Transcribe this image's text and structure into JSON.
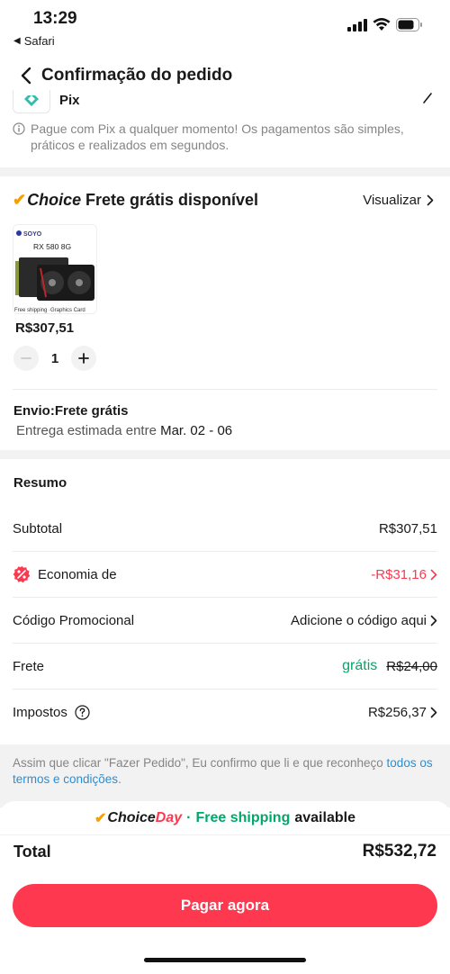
{
  "status_bar": {
    "time": "13:29",
    "back_app": "Safari"
  },
  "header": {
    "title": "Confirmação do pedido"
  },
  "payment": {
    "method_label": "Pix",
    "info_text": "Pague com Pix a qualquer momento! Os pagamentos são simples, práticos e realizados em segundos."
  },
  "choice_section": {
    "logo": "Choice",
    "title": "Frete grátis disponível",
    "view_label": "Visualizar",
    "product": {
      "image_brand": "SOYO",
      "image_model": "RX 580 8G",
      "image_caption": "Free shipping ·Graphics Card",
      "price": "R$307,51",
      "quantity": "1"
    },
    "shipping": {
      "title": "Envio:Frete grátis",
      "estimate_prefix": "Entrega estimada entre ",
      "estimate_dates": "Mar. 02 - 06"
    }
  },
  "summary": {
    "title": "Resumo",
    "rows": [
      {
        "label": "Subtotal",
        "value": "R$307,51"
      },
      {
        "label": "Economia de",
        "value": "-R$31,16"
      },
      {
        "label": "Código Promocional",
        "value": "Adicione o código aqui"
      },
      {
        "label": "Frete",
        "value_free": "grátis",
        "value_old": "R$24,00"
      },
      {
        "label": "Impostos",
        "value": "R$256,37"
      }
    ]
  },
  "legal": {
    "text": "Assim que clicar \"Fazer Pedido\", Eu confirmo que li e que reconheço ",
    "link": "todos os termos e condições",
    "suffix": "."
  },
  "banner": {
    "choice": "Choice",
    "day": "Day",
    "dot": "·",
    "free_shipping": "Free shipping",
    "available": "available"
  },
  "total": {
    "label": "Total",
    "value": "R$532,72"
  },
  "pay_button": {
    "label": "Pagar agora"
  },
  "colors": {
    "accent_red": "#fd384f",
    "green": "#00a86b",
    "choice_orange": "#f5a000",
    "link_blue": "#2a8fd4"
  }
}
